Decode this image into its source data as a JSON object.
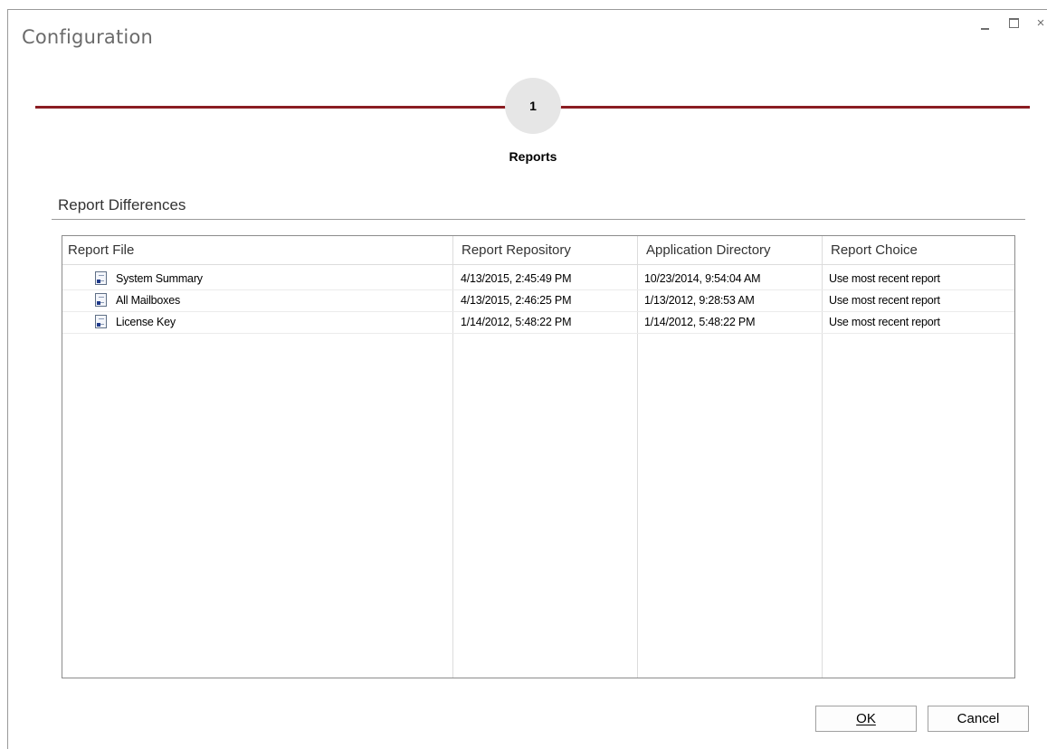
{
  "window": {
    "title": "Configuration",
    "controls": {
      "minimize": "minimize",
      "maximize": "maximize",
      "close": "×"
    }
  },
  "stepper": {
    "step_number": "1",
    "step_label": "Reports",
    "line_color": "#8b1d22"
  },
  "section": {
    "title": "Report Differences"
  },
  "table": {
    "columns": [
      "Report File",
      "Report Repository",
      "Application Directory",
      "Report Choice"
    ],
    "rows": [
      {
        "file": "System Summary",
        "repository": "4/13/2015, 2:45:49 PM",
        "app_dir": "10/23/2014, 9:54:04 AM",
        "choice": "Use most recent report",
        "icon": "report-document-icon"
      },
      {
        "file": "All Mailboxes",
        "repository": "4/13/2015, 2:46:25 PM",
        "app_dir": "1/13/2012, 9:28:53 AM",
        "choice": "Use most recent report",
        "icon": "report-document-icon"
      },
      {
        "file": "License Key",
        "repository": "1/14/2012, 5:48:22 PM",
        "app_dir": "1/14/2012, 5:48:22 PM",
        "choice": "Use most recent report",
        "icon": "report-document-icon"
      }
    ]
  },
  "buttons": {
    "ok": "OK",
    "cancel": "Cancel"
  }
}
